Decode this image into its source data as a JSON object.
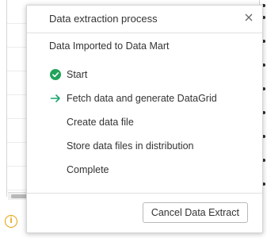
{
  "dialog": {
    "title": "Data extraction process",
    "subtitle": "Data Imported to Data Mart",
    "steps": [
      {
        "label": "Start",
        "status": "complete",
        "icon": "check-circle-icon"
      },
      {
        "label": "Fetch data and generate DataGrid",
        "status": "in-progress",
        "icon": "arrow-right-icon"
      },
      {
        "label": "Create data file",
        "status": "pending",
        "icon": ""
      },
      {
        "label": "Store data files in distribution",
        "status": "pending",
        "icon": ""
      },
      {
        "label": "Complete",
        "status": "pending",
        "icon": ""
      }
    ],
    "cancel_label": "Cancel Data Extract",
    "close_icon": "close-icon"
  },
  "background": {
    "info_icon": "info-icon",
    "info_glyph": "i"
  },
  "colors": {
    "success": "#22a35a",
    "in_progress": "#1aa570",
    "warning": "#e0a100"
  }
}
